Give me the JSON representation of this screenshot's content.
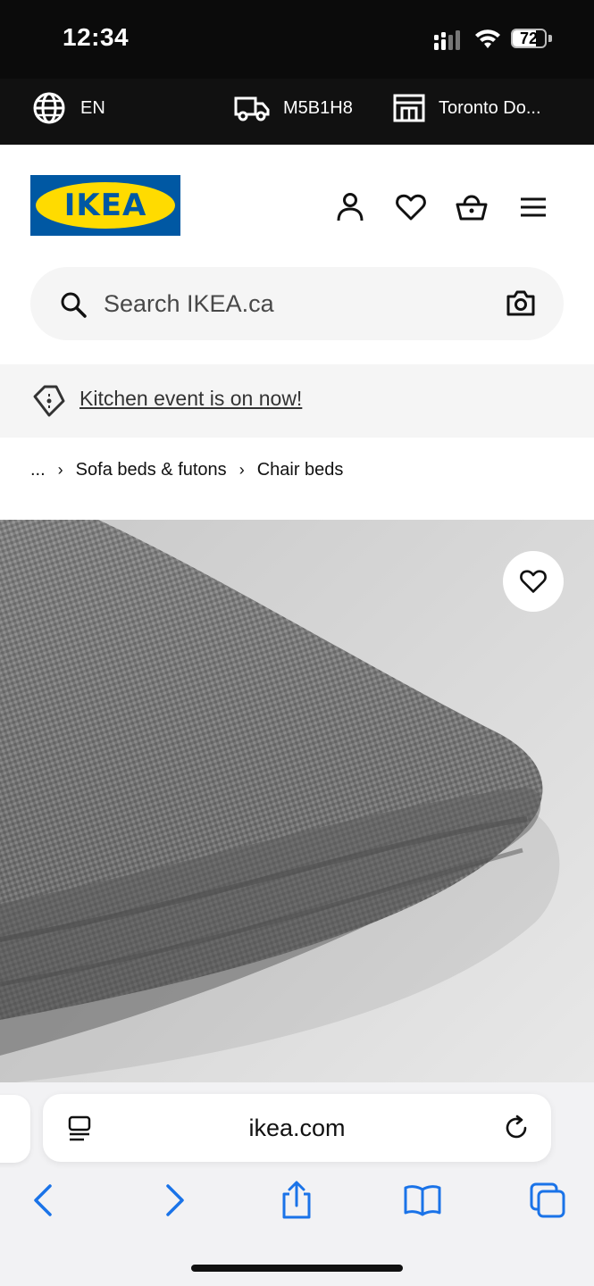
{
  "status_bar": {
    "time": "12:34",
    "battery": "72",
    "battery_level": 0.72
  },
  "top_bar": {
    "language": "EN",
    "postal_code": "M5B1H8",
    "store": "Toronto Do..."
  },
  "header": {
    "logo_text": "IKEA"
  },
  "search": {
    "placeholder": "Search IKEA.ca"
  },
  "promo": {
    "text": "Kitchen event is on now!"
  },
  "breadcrumb": {
    "items": [
      "...",
      "Sofa beds & futons",
      "Chair beds"
    ]
  },
  "browser": {
    "url": "ikea.com"
  },
  "colors": {
    "ikea_blue": "#0058a3",
    "ikea_yellow": "#ffdb00",
    "safari_blue": "#1a73e8"
  }
}
